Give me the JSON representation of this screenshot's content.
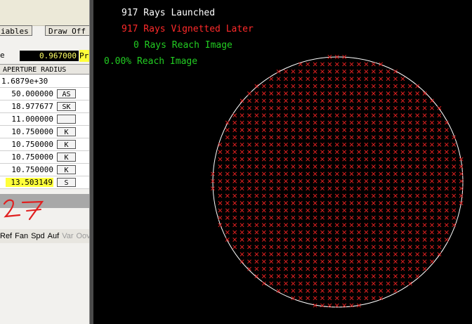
{
  "left_panel": {
    "toolbar_buttons": [
      "iables",
      "Draw Off"
    ],
    "field_label": "e",
    "field_value": "0.967000",
    "field_suffix": "Pr",
    "column_header": "APERTURE RADIUS",
    "rows": [
      {
        "value": "1.6879e+30",
        "btn": ""
      },
      {
        "value": "50.000000",
        "btn": "AS"
      },
      {
        "value": "18.977677",
        "btn": "SK"
      },
      {
        "value": "11.000000",
        "btn": ""
      },
      {
        "value": "10.750000",
        "btn": "K"
      },
      {
        "value": "10.750000",
        "btn": "K"
      },
      {
        "value": "10.750000",
        "btn": "K"
      },
      {
        "value": "10.750000",
        "btn": "K"
      },
      {
        "value": "13.503149",
        "btn": "S"
      }
    ],
    "tool_items": [
      "Ref",
      "Fan",
      "Spd",
      "Auf",
      "Var",
      "Oov"
    ]
  },
  "plot": {
    "line1": "917 Rays Launched",
    "line2": "917 Rays Vignetted Later",
    "line3": "0 Rays Reach Image",
    "line4": "0.00% Reach Image",
    "colors": {
      "launched": "#ffffff",
      "vignetted": "#ff2a2a",
      "reach": "#22cc22",
      "marker": "#e02020",
      "circle": "#ffffff"
    },
    "marker_icon": "x-mark"
  }
}
